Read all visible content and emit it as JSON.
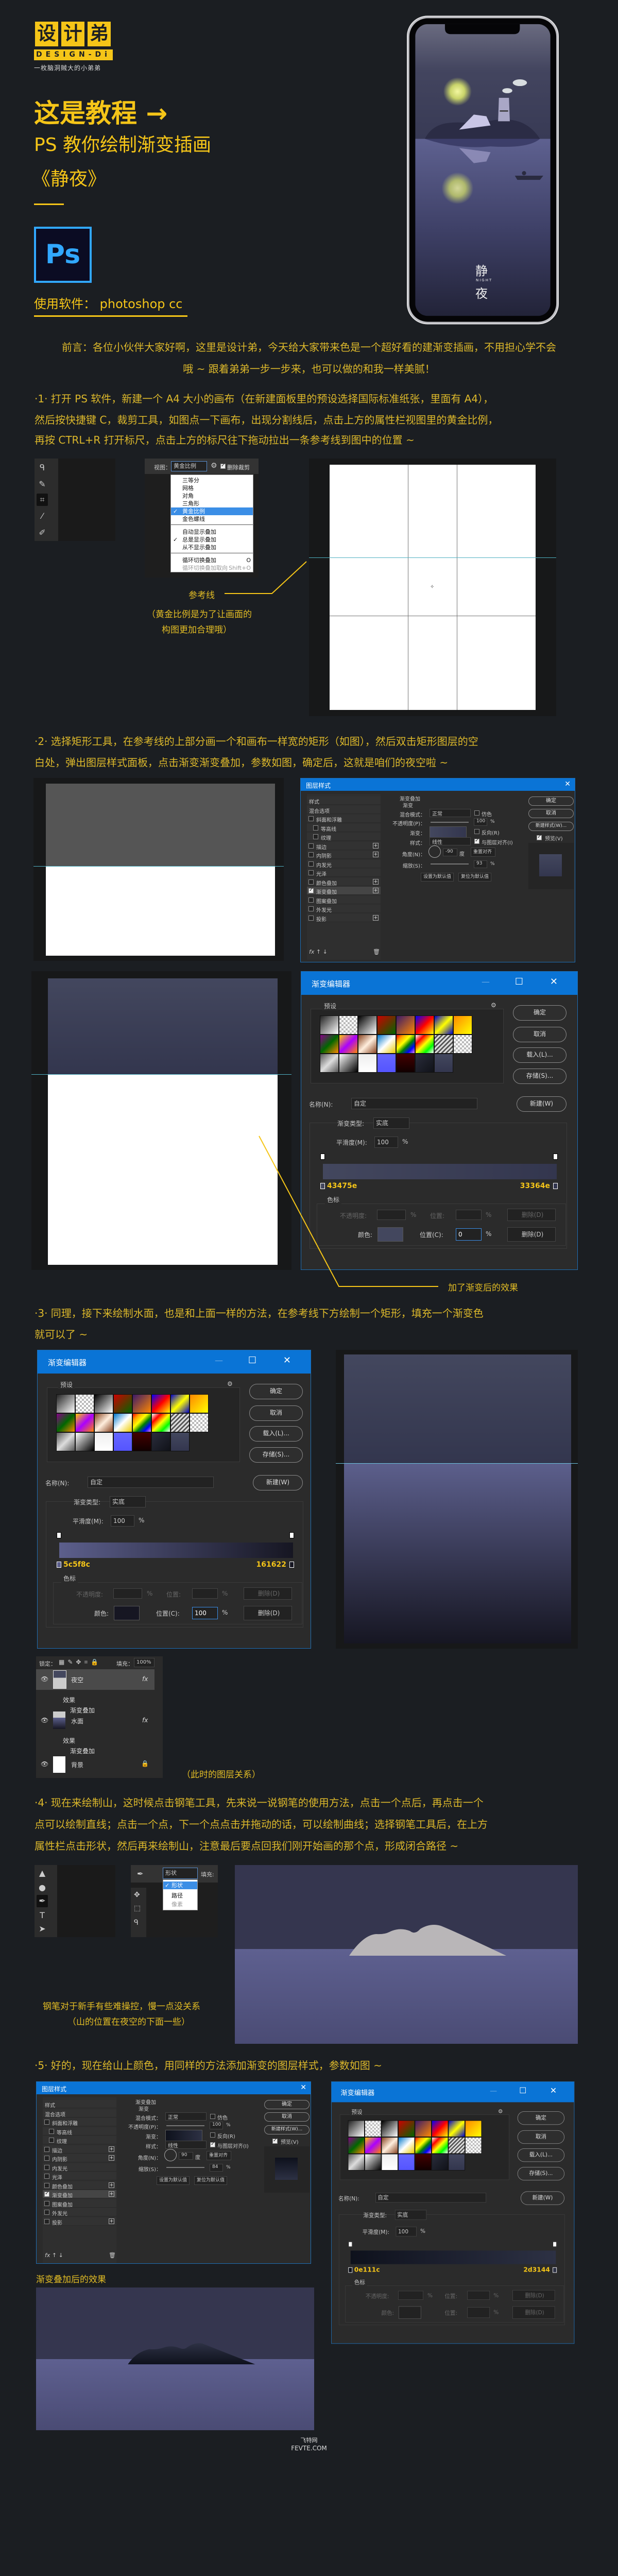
{
  "colors": {
    "background": "#1b1e22",
    "accent_yellow": "#f5c518",
    "text_yellow": "#dcb82b",
    "ps_blue": "#31a8ff",
    "dialog_blue": "#0a74d6"
  },
  "logo": {
    "chars": [
      "设",
      "计",
      "弟"
    ],
    "en": "DESIGN-Di",
    "tagline": "一枚脑洞贼大的小弟弟"
  },
  "hero": {
    "title": "这是教程 →",
    "subtitle": "PS 教你绘制渐变插画",
    "name": "《静夜》",
    "ps_icon": "Ps",
    "software": "使用软件：  photoshop cc"
  },
  "phone": {
    "title_top": "静",
    "title_mid": "NIGHT",
    "title_bottom": "夜"
  },
  "intro": {
    "lines": [
      "前言：各位小伙伴大家好啊，这里是设计弟，今天给大家带来色是一个超好看的建渐变插画，不用担心学不会",
      "哦 ~ 跟着弟弟一步一步来，也可以做的和我一样美腻！"
    ]
  },
  "steps": [
    {
      "lines": [
        "·1· 打开 PS 软件，新建一个 A4 大小的画布（在新建面板里的预设选择国际标准纸张，里面有 A4），",
        "然后按快捷键 C，裁剪工具，如图点一下画布，出现分割线后，点击上方的属性栏视图里的黄金比例，",
        "再按 CTRL+R 打开标尺，点击上方的标尺往下拖动拉出一条参考线到图中的位置 ~"
      ]
    },
    {
      "lines": [
        "·2· 选择矩形工具，在参考线的上部分画一个和画布一样宽的矩形（如图），然后双击矩形图层的空",
        "白处，弹出图层样式面板，点击渐变渐变叠加，参数如图，确定后，这就是咱们的夜空啦 ~"
      ]
    },
    {
      "lines": [
        "·3· 同理，接下来绘制水面，也是和上面一样的方法，在参考线下方绘制一个矩形，填充一个渐变色",
        "就可以了 ~"
      ]
    },
    {
      "lines": [
        "·4· 现在来绘制山，这时候点击钢笔工具，先来说一说钢笔的使用方法，点击一个点后，再点击一个",
        "点可以绘制直线；点击一个点，下一个点点击并拖动的话，可以绘制曲线；选择钢笔工具后，在上方",
        "属性栏点击形状，然后再来绘制山，注意最后要点回我们刚开始画的那个点，形成闭合路径 ~"
      ]
    },
    {
      "lines": [
        "·5· 好的，现在给山上颜色，用同样的方法添加渐变的图层样式，参数如图 ~"
      ]
    }
  ],
  "step1": {
    "view_label": "视图：",
    "view_value": "黄金比例",
    "delete_crop": "删除裁剪",
    "overlay_items": [
      {
        "label": "三等分"
      },
      {
        "label": "网格"
      },
      {
        "label": "对角"
      },
      {
        "label": "三角形"
      },
      {
        "label": "黄金比例",
        "checked": true
      },
      {
        "label": "金色螺线"
      }
    ],
    "display_items": [
      {
        "label": "自动显示叠加"
      },
      {
        "label": "总是显示叠加",
        "checked": true
      },
      {
        "label": "从不显示叠加"
      }
    ],
    "cycle_items": [
      {
        "label": "循环切换叠加",
        "shortcut": "O"
      },
      {
        "label": "循环切换叠加取向",
        "shortcut": "Shift+O"
      }
    ],
    "annotation": "参考线",
    "note_lines": [
      "（黄金比例是为了让画面的",
      "构图更加合理哦）"
    ]
  },
  "ls": {
    "title": "图层样式",
    "items": [
      {
        "label": "样式"
      },
      {
        "label": "混合选项"
      },
      {
        "label": "斜面和浮雕"
      },
      {
        "label": "等高线"
      },
      {
        "label": "纹理"
      },
      {
        "label": "描边"
      },
      {
        "label": "内阴影"
      },
      {
        "label": "内发光"
      },
      {
        "label": "光泽"
      },
      {
        "label": "颜色叠加"
      },
      {
        "label": "渐变叠加",
        "checked": true
      },
      {
        "label": "图案叠加"
      },
      {
        "label": "外发光"
      },
      {
        "label": "投影"
      }
    ],
    "section": "渐变叠加",
    "subsection": "渐变",
    "blend_label": "混合模式：",
    "blend_value": "正常",
    "dither": "仿色",
    "opacity_label": "不透明度(P)：",
    "gradient_label": "渐变：",
    "reverse": "反向(R)",
    "style_label": "样式：",
    "style_value": "线性",
    "align": "与图层对齐(I)",
    "angle_label": "角度(N)：",
    "degree": "度",
    "reset_align": "重置对齐",
    "scale_label": "缩放(S)：",
    "percent": "%",
    "set_default": "设置为默认值",
    "reset_default": "复位为默认值",
    "ok": "确定",
    "cancel": "取消",
    "new_style": "新建样式(W)...",
    "preview": "预览(V)"
  },
  "ge": {
    "title": "渐变编辑器",
    "presets": "预设",
    "ok": "确定",
    "cancel": "取消",
    "load": "载入(L)...",
    "save": "存储(S)...",
    "name_label": "名称(N):",
    "name_value": "自定",
    "new": "新建(W)",
    "type_label": "渐变类型:",
    "type_value": "实底",
    "smooth_label": "平滑度(M):",
    "smooth_value": "100",
    "percent": "%",
    "stops_label": "色标",
    "opacity_label": "不透明度:",
    "location_label": "位置:",
    "delete": "删除(D)",
    "color_label": "颜色:",
    "location_c_label": "位置(C):"
  },
  "step2": {
    "layer_style": {
      "opacity": "100",
      "angle": "-90",
      "scale": "93",
      "gradient_from": "#43475e",
      "gradient_to": "#33364e"
    },
    "gradient_editor": {
      "stop_left": "43475e",
      "stop_right": "33364e",
      "color": "#43475e",
      "location": "0"
    },
    "caption": "加了渐变后的效果"
  },
  "step3": {
    "gradient_editor": {
      "stop_left": "5c5f8c",
      "stop_right": "161622",
      "color": "#161622",
      "location": "100"
    },
    "layers_panel": {
      "lock_label": "锁定：",
      "fill_label": "填充：",
      "fill_value": "100%",
      "layers": [
        {
          "name": "夜空",
          "effects": "效果",
          "effect": "渐变叠加"
        },
        {
          "name": "水面",
          "effects": "效果",
          "effect": "渐变叠加"
        },
        {
          "name": "背景"
        }
      ]
    },
    "caption": "（此时的图层关系）"
  },
  "step4": {
    "mode_value": "形状",
    "fill_label": "填充:",
    "mode_items": [
      {
        "label": "形状",
        "checked": true
      },
      {
        "label": "路径"
      },
      {
        "label": "像素"
      }
    ],
    "caption_lines": [
      "钢笔对于新手有些难操控，慢一点没关系",
      "（山的位置在夜空的下面一些）"
    ]
  },
  "step5": {
    "layer_style": {
      "opacity": "100",
      "angle": "90",
      "scale": "84",
      "gradient_from": "#0e111c",
      "gradient_to": "#2d3144"
    },
    "gradient_editor": {
      "stop_left": "0e111c",
      "stop_right": "2d3144",
      "color": "",
      "location": ""
    },
    "caption": "渐变叠加后的效果"
  },
  "watermark": {
    "cn": "飞特网",
    "en": "FEVTE.COM"
  }
}
